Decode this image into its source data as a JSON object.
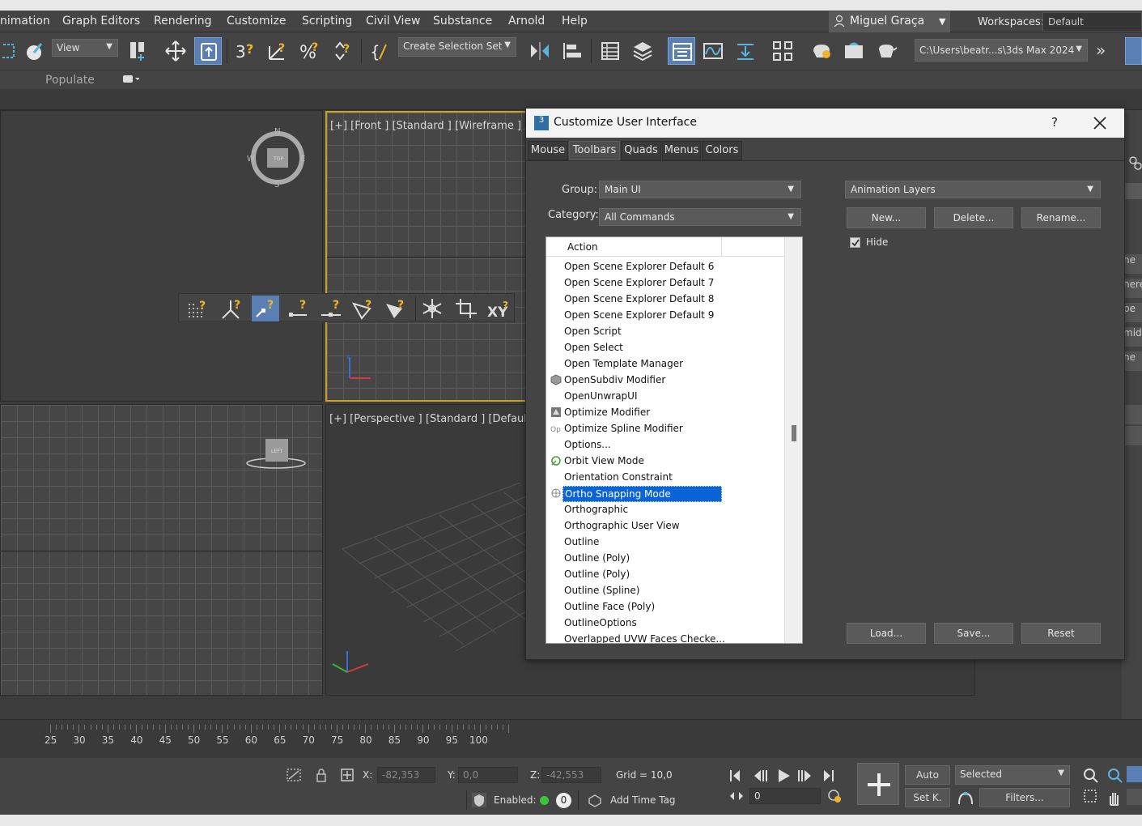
{
  "menubar": {
    "items": [
      "nimation",
      "Graph Editors",
      "Rendering",
      "Customize",
      "Scripting",
      "Civil View",
      "Substance",
      "Arnold",
      "Help"
    ],
    "user": "Miguel Graça",
    "workspaces_label": "Workspaces:",
    "workspace_value": "Default"
  },
  "toolbar": {
    "view_dropdown": "View",
    "selection_set": "Create Selection Set",
    "project_path": "C:\\Users\\beatr...s\\3ds Max 2024"
  },
  "ribbon": {
    "populate": "Populate"
  },
  "viewports": {
    "front_label": "[+] [Front ] [Standard ] [Wireframe ]",
    "perspective_label": "[+] [Perspective ] [Standard ] [Default"
  },
  "timeline": {
    "ticks": [
      "25",
      "30",
      "35",
      "40",
      "45",
      "50",
      "55",
      "60",
      "65",
      "70",
      "75",
      "80",
      "85",
      "90",
      "95",
      "100"
    ]
  },
  "status": {
    "x_label": "X:",
    "x_value": "-82,353",
    "y_label": "Y:",
    "y_value": "0,0",
    "z_label": "Z:",
    "z_value": "-42,553",
    "grid": "Grid = 10,0",
    "enabled_label": "Enabled:",
    "enabled_count": "0",
    "add_time_tag": "Add Time Tag",
    "auto": "Auto",
    "selected": "Selected",
    "setk": "Set K.",
    "filters": "Filters...",
    "frame": "0"
  },
  "dialog": {
    "title": "Customize User Interface",
    "help": "?",
    "tabs": [
      "Mouse",
      "Toolbars",
      "Quads",
      "Menus",
      "Colors"
    ],
    "group_label": "Group:",
    "group_value": "Main UI",
    "category_label": "Category:",
    "category_value": "All Commands",
    "toolbar_select": "Animation Layers",
    "new_btn": "New...",
    "delete_btn": "Delete...",
    "rename_btn": "Rename...",
    "hide_label": "Hide",
    "load_btn": "Load...",
    "save_btn": "Save...",
    "reset_btn": "Reset",
    "list_header": "Action",
    "actions": [
      {
        "label": "Open Scene Explorer Default 6",
        "icon": ""
      },
      {
        "label": "Open Scene Explorer Default 7",
        "icon": ""
      },
      {
        "label": "Open Scene Explorer Default 8",
        "icon": ""
      },
      {
        "label": "Open Scene Explorer Default 9",
        "icon": ""
      },
      {
        "label": "Open Script",
        "icon": ""
      },
      {
        "label": "Open Select",
        "icon": ""
      },
      {
        "label": "Open Template Manager",
        "icon": ""
      },
      {
        "label": "OpenSubdiv Modifier",
        "icon": "cube-icon"
      },
      {
        "label": "OpenUnwrapUI",
        "icon": ""
      },
      {
        "label": "Optimize Modifier",
        "icon": "optimize-icon"
      },
      {
        "label": "Optimize Spline Modifier",
        "icon": "op-icon"
      },
      {
        "label": "Options...",
        "icon": ""
      },
      {
        "label": "Orbit View Mode",
        "icon": "orbit-icon"
      },
      {
        "label": "Orientation Constraint",
        "icon": ""
      },
      {
        "label": "Ortho Snapping Mode",
        "icon": "ortho-icon",
        "selected": true
      },
      {
        "label": "Orthographic",
        "icon": ""
      },
      {
        "label": "Orthographic User View",
        "icon": ""
      },
      {
        "label": "Outline",
        "icon": ""
      },
      {
        "label": "Outline (Poly)",
        "icon": ""
      },
      {
        "label": "Outline (Poly)",
        "icon": ""
      },
      {
        "label": "Outline (Spline)",
        "icon": ""
      },
      {
        "label": "Outline Face (Poly)",
        "icon": ""
      },
      {
        "label": "OutlineOptions",
        "icon": ""
      },
      {
        "label": "Overlapped UVW Faces Checke...",
        "icon": ""
      }
    ]
  },
  "cmdpanel": {
    "stubs": [
      "ne",
      "here",
      "pe",
      "mid",
      "ne"
    ]
  },
  "colors": {
    "accent": "#5a7fb5",
    "selection": "#0a64d8",
    "snap": "#f0b429"
  }
}
